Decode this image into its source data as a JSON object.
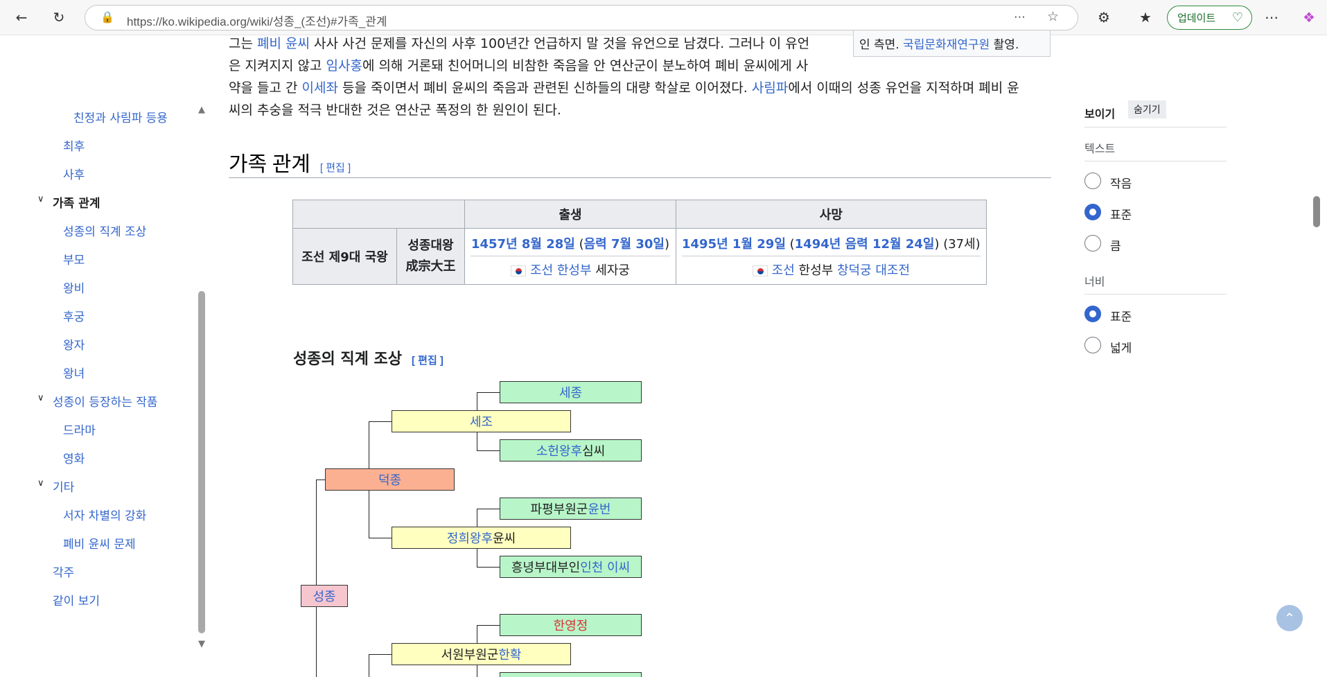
{
  "browser": {
    "url": "https://ko.wikipedia.org/wiki/성종_(조선)#가족_관계",
    "update_label": "업데이트"
  },
  "toc": {
    "items": [
      {
        "label": "친정과 사림파 등용",
        "level": 2
      },
      {
        "label": "최후",
        "level": 2
      },
      {
        "label": "사후",
        "level": 2
      },
      {
        "label": "가족 관계",
        "level": 1,
        "current": true
      },
      {
        "label": "성종의 직계 조상",
        "level": 2
      },
      {
        "label": "부모",
        "level": 2
      },
      {
        "label": "왕비",
        "level": 2
      },
      {
        "label": "후궁",
        "level": 2
      },
      {
        "label": "왕자",
        "level": 2
      },
      {
        "label": "왕녀",
        "level": 2
      },
      {
        "label": "성종이 등장하는 작품",
        "level": 1
      },
      {
        "label": "드라마",
        "level": 2
      },
      {
        "label": "영화",
        "level": 2
      },
      {
        "label": "기타",
        "level": 1
      },
      {
        "label": "서자 차별의 강화",
        "level": 2
      },
      {
        "label": "폐비 윤씨 문제",
        "level": 2
      },
      {
        "label": "각주",
        "level": 1
      },
      {
        "label": "같이 보기",
        "level": 1
      }
    ]
  },
  "article": {
    "caption_text": "인 측면. ",
    "caption_link": "국립문화재연구원",
    "caption_tail": " 촬영.",
    "p1_a": "그는 ",
    "p1_link1": "폐비 윤씨",
    "p1_b": " 사사 사건 문제를 자신의 사후 100년간 언급하지 말 것을 유언으로 남겼다. 그러나 이 유언",
    "p2_a": "은 지켜지지 않고 ",
    "p2_link1": "임사홍",
    "p2_b": "에 의해 거론돼 친어머니의 비참한 죽음을 안 연산군이 분노하여 폐비 윤씨에게 사",
    "p3_a": "약을 들고 간 ",
    "p3_link1": "이세좌",
    "p3_b": " 등을 죽이면서 폐비 윤씨의 죽음과 관련된 신하들의 대량 학살로 이어졌다. ",
    "p3_link2": "사림파",
    "p3_c": "에서 이때의 성종 유언을 지적하며 폐비 윤",
    "p4": "씨의 추숭을 적극 반대한 것은 연산군 폭정의 한 원인이 된다.",
    "h2": "가족 관계",
    "edit": "[ 편집 ]",
    "h3": "성종의 직계 조상"
  },
  "info_table": {
    "header_birth": "출생",
    "header_death": "사망",
    "row_title": "조선 제9대 국왕",
    "name_ko": "성종대왕",
    "name_hanja": "成宗大王",
    "birth_date": "1457년 8월 28일",
    "birth_lunar": "음력 7월 30일",
    "birth_country": "조선",
    "birth_city": "한성부",
    "birth_place": "세자궁",
    "death_date": "1495년 1월 29일",
    "death_lunar": "1494년 음력 12월 24일",
    "death_age": "(37세)",
    "death_country": "조선",
    "death_city": "한성부",
    "death_place": "창덕궁 대조전"
  },
  "tree": {
    "sejong": "세종",
    "sejo": "세조",
    "soheon_link": "소헌왕후",
    "soheon_tail": " 심씨",
    "deokjong": "덕종",
    "papyeong_a": "파평부원군 ",
    "papyeong_link": "윤번",
    "jeonghui_link": "정희왕후",
    "jeonghui_tail": " 윤씨",
    "heungnyeong_a": "흥녕부대부인 ",
    "heungnyeong_link": "인천 이씨",
    "seongjong": "성종",
    "hanyeongjeong": "한영정",
    "seowon_a": "서원부원군 ",
    "seowon_link": "한확"
  },
  "appearance": {
    "title": "보이기",
    "hide": "숨기기",
    "text_label": "텍스트",
    "text_options": [
      "작음",
      "표준",
      "큼"
    ],
    "text_selected": "표준",
    "width_label": "너비",
    "width_options": [
      "표준",
      "넓게"
    ],
    "width_selected": "표준"
  }
}
